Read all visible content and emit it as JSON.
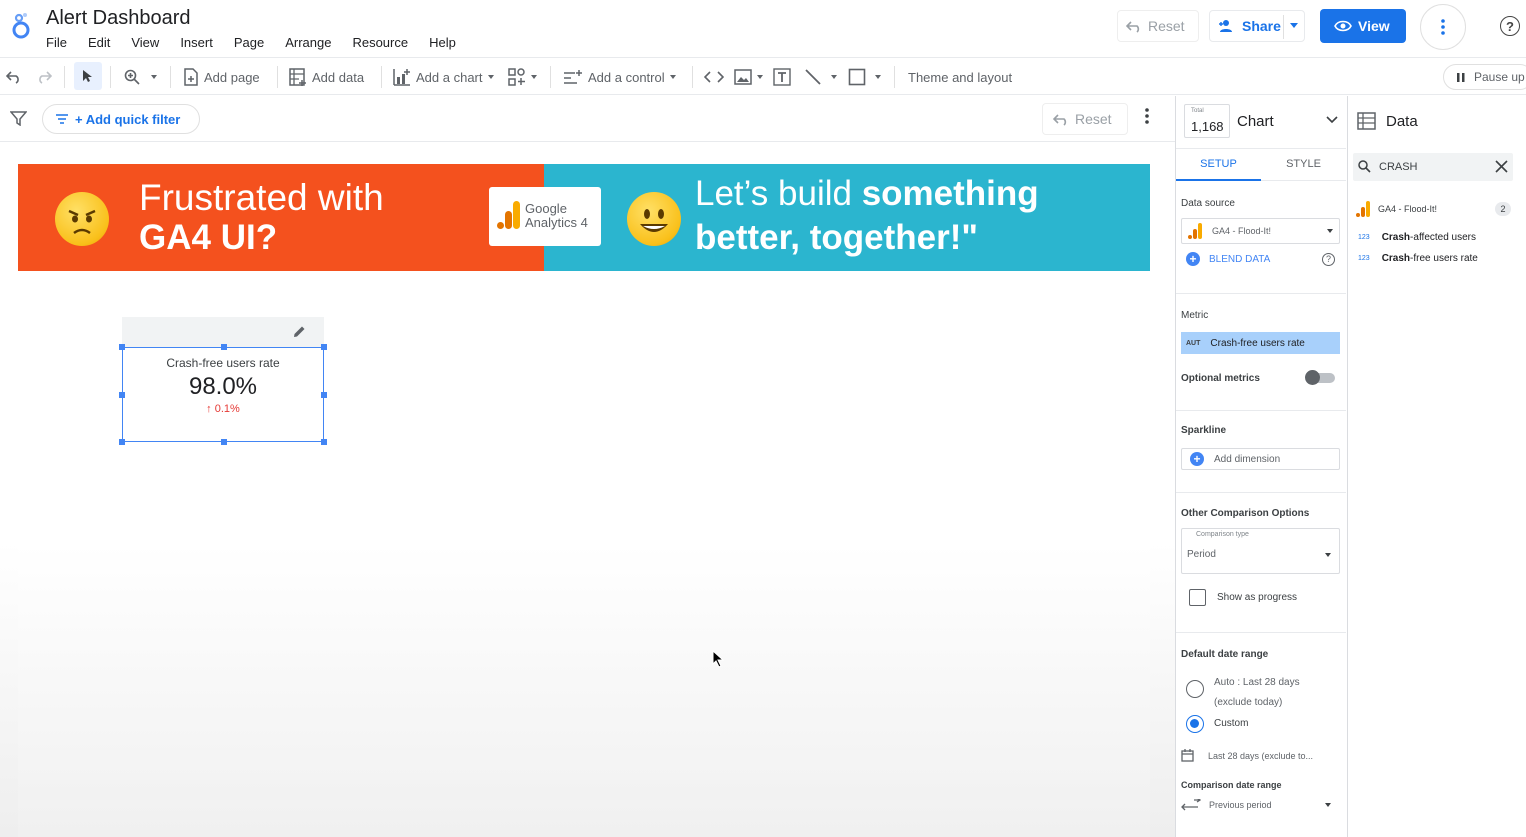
{
  "header": {
    "doc_title": "Alert Dashboard",
    "menu": [
      "File",
      "Edit",
      "View",
      "Insert",
      "Page",
      "Arrange",
      "Resource",
      "Help"
    ],
    "reset_label": "Reset",
    "share_label": "Share",
    "view_label": "View"
  },
  "toolbar": {
    "add_page": "Add page",
    "add_data": "Add data",
    "add_chart": "Add a chart",
    "add_control": "Add a control",
    "theme_layout": "Theme and layout",
    "pause_label": "Pause up"
  },
  "filterbar": {
    "quick_filter": "+ Add quick filter",
    "reset_label": "Reset"
  },
  "banner": {
    "left_line1": "Frustrated with",
    "left_line2": "GA4 UI?",
    "logo_line1": "Google",
    "logo_line2": "Analytics 4",
    "right_line1_plain": "Let’s build ",
    "right_line1_bold": "something",
    "right_line2": "better, together!\""
  },
  "scorecard": {
    "title": "Crash-free users rate",
    "value": "98.0%",
    "delta": "0.1%",
    "delta_color": "#e53935"
  },
  "properties": {
    "total_label": "Total",
    "total_value": "1,168",
    "chart_label": "Chart",
    "tabs": [
      "SETUP",
      "STYLE"
    ],
    "data_source_label": "Data source",
    "data_source_value": "GA4 - Flood-It!",
    "blend_data": "BLEND DATA",
    "metric_label": "Metric",
    "metric_tag": "AUT",
    "metric_value": "Crash-free users rate",
    "optional_metrics": "Optional metrics",
    "sparkline_label": "Sparkline",
    "add_dimension": "Add dimension",
    "other_comparison": "Other Comparison Options",
    "comparison_type_label": "Comparison type",
    "comparison_type_value": "Period",
    "show_as_progress": "Show as progress",
    "default_date_range": "Default date range",
    "auto_line1": "Auto : Last 28 days",
    "auto_line2": "(exclude today)",
    "custom_label": "Custom",
    "custom_range": "Last 28 days (exclude to...",
    "comparison_date_range": "Comparison date range",
    "previous_period": "Previous period"
  },
  "data_panel": {
    "title": "Data",
    "search_value": "CRASH",
    "data_source": "GA4 - Flood-It!",
    "data_source_count": "2",
    "fields": [
      {
        "tag": "123",
        "bold": "Crash",
        "rest": "-affected users"
      },
      {
        "tag": "123",
        "bold": "Crash",
        "rest": "-free users rate"
      }
    ]
  },
  "colors": {
    "accent": "#1a73e8",
    "banner_orange": "#f4511e",
    "banner_teal": "#2bb5cf",
    "selection": "#4285f4"
  }
}
